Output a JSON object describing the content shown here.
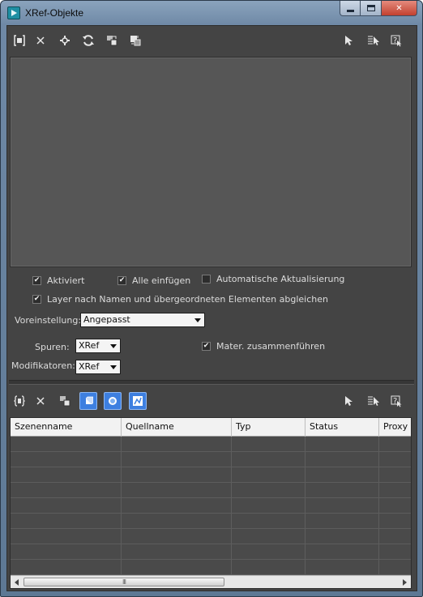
{
  "window": {
    "title": "XRef-Objekte"
  },
  "top_toolbar": {
    "buttons": [
      "add-scene-icon",
      "remove-icon",
      "merge-icon",
      "refresh-icon",
      "convert-icon",
      "bind-icon",
      "select-icon",
      "select-by-list-icon",
      "help-icon"
    ]
  },
  "options": {
    "aktiviert": "Aktiviert",
    "alle_einfuegen": "Alle einfügen",
    "auto_update": "Automatische Aktualisierung",
    "layer_match": "Layer nach Namen und übergeordneten Elementen abgleichen",
    "aktiviert_checked": true,
    "alle_einfuegen_checked": true,
    "auto_update_checked": false,
    "layer_match_checked": true,
    "mater_merge": "Mater. zusammenführen",
    "mater_merge_checked": true
  },
  "preset": {
    "label": "Voreinstellung:",
    "value": "Angepasst"
  },
  "tracks": {
    "label": "Spuren:",
    "value": "XRef"
  },
  "modifiers": {
    "label": "Modifikatoren:",
    "value": "XRef"
  },
  "bottom_toolbar": {
    "buttons": [
      "add-object-icon",
      "remove-icon",
      "merge-icon",
      "object-mode-icon",
      "material-mode-icon",
      "controller-mode-icon",
      "select-icon",
      "select-by-list-icon",
      "help-icon"
    ]
  },
  "table": {
    "columns": [
      "Szenenname",
      "Quellname",
      "Typ",
      "Status",
      "Proxy"
    ],
    "rows": 9,
    "scrollbar_grip": "III"
  },
  "colors": {
    "accent": "#3d7fe0",
    "panel": "#444444",
    "viewport": "#565656"
  }
}
